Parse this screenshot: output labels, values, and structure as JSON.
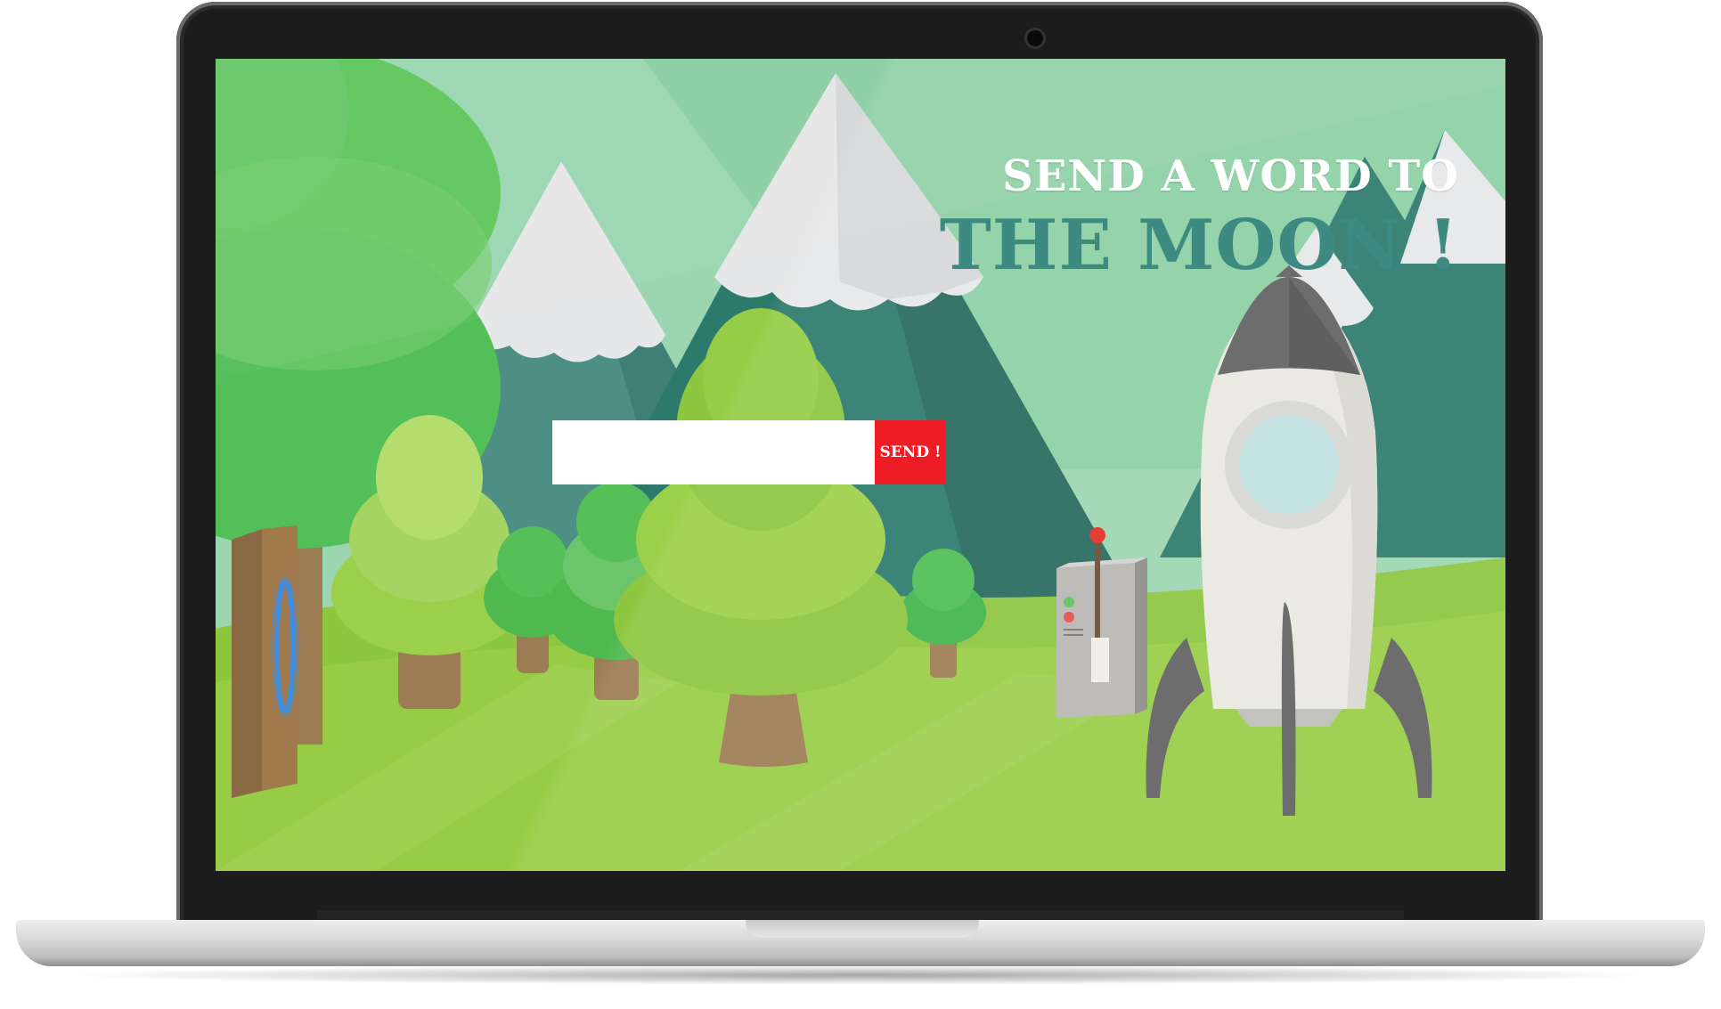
{
  "page": {
    "headline_line1": "SEND A WORD TO",
    "headline_line2": "THE MOON !"
  },
  "form": {
    "input_value": "",
    "input_placeholder": "",
    "send_label": "SEND !"
  },
  "colors": {
    "sky": "#9bd6b0",
    "mountain_dark": "#2c7a6c",
    "grass": "#8dc63f",
    "send_button": "#ee1c25",
    "headline_accent": "#3d8a83",
    "portal_glow": "#3a8ee6"
  },
  "scene": {
    "elements": [
      "mountains-with-snow",
      "trees",
      "tree-trunk-portal",
      "launch-lever-box",
      "rocket"
    ]
  }
}
